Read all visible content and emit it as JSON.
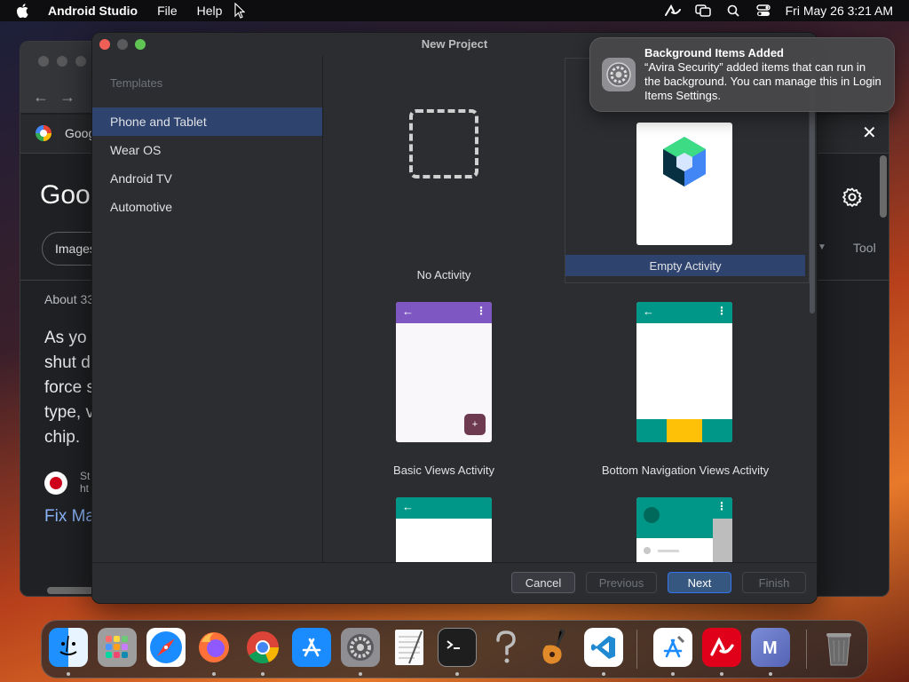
{
  "menubar": {
    "app_name": "Android Studio",
    "menus": [
      "File",
      "Help"
    ],
    "clock": "Fri May 26  3:21 AM",
    "status_icons": [
      "avira-icon",
      "screen-mirroring-icon",
      "spotlight-search-icon",
      "control-center-icon"
    ]
  },
  "browser": {
    "tab_title": "Goog",
    "logo_text": "Goo",
    "images_chip": "Images",
    "tools_label": "Tool",
    "result_stats": "About 33",
    "snippet_lines": [
      "As yo",
      "shut d",
      "force s",
      "type, v",
      "chip. "
    ],
    "site_name": "St",
    "site_url": "ht",
    "result_link": "Fix Ma"
  },
  "dialog": {
    "title": "New Project",
    "templates_label": "Templates",
    "categories": [
      "Phone and Tablet",
      "Wear OS",
      "Android TV",
      "Automotive"
    ],
    "selected_category": "Phone and Tablet",
    "templates": [
      {
        "label": "No Activity"
      },
      {
        "label": "Empty Activity",
        "selected": true
      },
      {
        "label": "Basic Views Activity"
      },
      {
        "label": "Bottom Navigation Views Activity"
      }
    ],
    "buttons": {
      "cancel": "Cancel",
      "previous": "Previous",
      "next": "Next",
      "finish": "Finish"
    },
    "fab_symbol": "+"
  },
  "notification": {
    "title": "Background Items Added",
    "body": "“Avira Security” added items that can run in the background. You can manage this in Login Items Settings."
  },
  "dock": {
    "apps": [
      "finder",
      "launchpad",
      "safari",
      "firefox",
      "chrome",
      "app-store",
      "system-settings",
      "textedit",
      "terminal",
      "help",
      "garageband",
      "vscode",
      "xcode-instruments",
      "avira",
      "m-app",
      "trash"
    ],
    "running": [
      "finder",
      "firefox",
      "chrome",
      "system-settings",
      "terminal",
      "vscode",
      "xcode-instruments",
      "avira",
      "m-app"
    ]
  },
  "colors": {
    "dialog_bg": "#2b2d30",
    "selection": "#2e436e",
    "purple_toolbar": "#7e57c2",
    "teal_toolbar": "#009688",
    "nav_yellow": "#ffc107",
    "fab": "#6d3a4f"
  }
}
